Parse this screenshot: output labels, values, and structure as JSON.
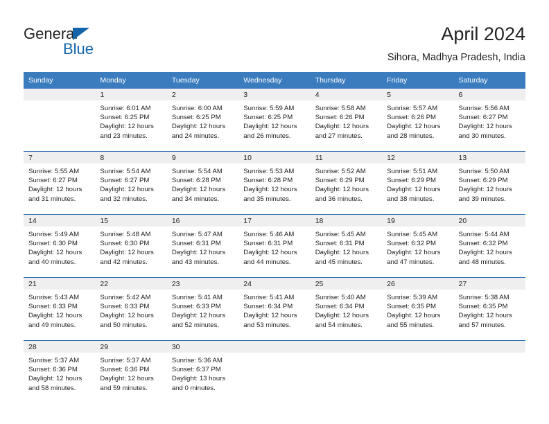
{
  "brand": {
    "name_part1": "General",
    "name_part2": "Blue",
    "logo_icon": "blue-triangle-logo"
  },
  "header": {
    "title": "April 2024",
    "subtitle": "Sihora, Madhya Pradesh, India"
  },
  "colors": {
    "header_blue": "#3b7cbf",
    "separator_blue": "#2f6daf",
    "daynum_band": "#efefef",
    "brand_blue": "#1464aa",
    "text": "#222222"
  },
  "weekday_headers": [
    "Sunday",
    "Monday",
    "Tuesday",
    "Wednesday",
    "Thursday",
    "Friday",
    "Saturday"
  ],
  "weeks": [
    [
      {
        "day": "",
        "sunrise": "",
        "sunset": "",
        "daylight_line1": "",
        "daylight_line2": ""
      },
      {
        "day": "1",
        "sunrise": "Sunrise: 6:01 AM",
        "sunset": "Sunset: 6:25 PM",
        "daylight_line1": "Daylight: 12 hours",
        "daylight_line2": "and 23 minutes."
      },
      {
        "day": "2",
        "sunrise": "Sunrise: 6:00 AM",
        "sunset": "Sunset: 6:25 PM",
        "daylight_line1": "Daylight: 12 hours",
        "daylight_line2": "and 24 minutes."
      },
      {
        "day": "3",
        "sunrise": "Sunrise: 5:59 AM",
        "sunset": "Sunset: 6:25 PM",
        "daylight_line1": "Daylight: 12 hours",
        "daylight_line2": "and 26 minutes."
      },
      {
        "day": "4",
        "sunrise": "Sunrise: 5:58 AM",
        "sunset": "Sunset: 6:26 PM",
        "daylight_line1": "Daylight: 12 hours",
        "daylight_line2": "and 27 minutes."
      },
      {
        "day": "5",
        "sunrise": "Sunrise: 5:57 AM",
        "sunset": "Sunset: 6:26 PM",
        "daylight_line1": "Daylight: 12 hours",
        "daylight_line2": "and 28 minutes."
      },
      {
        "day": "6",
        "sunrise": "Sunrise: 5:56 AM",
        "sunset": "Sunset: 6:27 PM",
        "daylight_line1": "Daylight: 12 hours",
        "daylight_line2": "and 30 minutes."
      }
    ],
    [
      {
        "day": "7",
        "sunrise": "Sunrise: 5:55 AM",
        "sunset": "Sunset: 6:27 PM",
        "daylight_line1": "Daylight: 12 hours",
        "daylight_line2": "and 31 minutes."
      },
      {
        "day": "8",
        "sunrise": "Sunrise: 5:54 AM",
        "sunset": "Sunset: 6:27 PM",
        "daylight_line1": "Daylight: 12 hours",
        "daylight_line2": "and 32 minutes."
      },
      {
        "day": "9",
        "sunrise": "Sunrise: 5:54 AM",
        "sunset": "Sunset: 6:28 PM",
        "daylight_line1": "Daylight: 12 hours",
        "daylight_line2": "and 34 minutes."
      },
      {
        "day": "10",
        "sunrise": "Sunrise: 5:53 AM",
        "sunset": "Sunset: 6:28 PM",
        "daylight_line1": "Daylight: 12 hours",
        "daylight_line2": "and 35 minutes."
      },
      {
        "day": "11",
        "sunrise": "Sunrise: 5:52 AM",
        "sunset": "Sunset: 6:29 PM",
        "daylight_line1": "Daylight: 12 hours",
        "daylight_line2": "and 36 minutes."
      },
      {
        "day": "12",
        "sunrise": "Sunrise: 5:51 AM",
        "sunset": "Sunset: 6:29 PM",
        "daylight_line1": "Daylight: 12 hours",
        "daylight_line2": "and 38 minutes."
      },
      {
        "day": "13",
        "sunrise": "Sunrise: 5:50 AM",
        "sunset": "Sunset: 6:29 PM",
        "daylight_line1": "Daylight: 12 hours",
        "daylight_line2": "and 39 minutes."
      }
    ],
    [
      {
        "day": "14",
        "sunrise": "Sunrise: 5:49 AM",
        "sunset": "Sunset: 6:30 PM",
        "daylight_line1": "Daylight: 12 hours",
        "daylight_line2": "and 40 minutes."
      },
      {
        "day": "15",
        "sunrise": "Sunrise: 5:48 AM",
        "sunset": "Sunset: 6:30 PM",
        "daylight_line1": "Daylight: 12 hours",
        "daylight_line2": "and 42 minutes."
      },
      {
        "day": "16",
        "sunrise": "Sunrise: 5:47 AM",
        "sunset": "Sunset: 6:31 PM",
        "daylight_line1": "Daylight: 12 hours",
        "daylight_line2": "and 43 minutes."
      },
      {
        "day": "17",
        "sunrise": "Sunrise: 5:46 AM",
        "sunset": "Sunset: 6:31 PM",
        "daylight_line1": "Daylight: 12 hours",
        "daylight_line2": "and 44 minutes."
      },
      {
        "day": "18",
        "sunrise": "Sunrise: 5:45 AM",
        "sunset": "Sunset: 6:31 PM",
        "daylight_line1": "Daylight: 12 hours",
        "daylight_line2": "and 45 minutes."
      },
      {
        "day": "19",
        "sunrise": "Sunrise: 5:45 AM",
        "sunset": "Sunset: 6:32 PM",
        "daylight_line1": "Daylight: 12 hours",
        "daylight_line2": "and 47 minutes."
      },
      {
        "day": "20",
        "sunrise": "Sunrise: 5:44 AM",
        "sunset": "Sunset: 6:32 PM",
        "daylight_line1": "Daylight: 12 hours",
        "daylight_line2": "and 48 minutes."
      }
    ],
    [
      {
        "day": "21",
        "sunrise": "Sunrise: 5:43 AM",
        "sunset": "Sunset: 6:33 PM",
        "daylight_line1": "Daylight: 12 hours",
        "daylight_line2": "and 49 minutes."
      },
      {
        "day": "22",
        "sunrise": "Sunrise: 5:42 AM",
        "sunset": "Sunset: 6:33 PM",
        "daylight_line1": "Daylight: 12 hours",
        "daylight_line2": "and 50 minutes."
      },
      {
        "day": "23",
        "sunrise": "Sunrise: 5:41 AM",
        "sunset": "Sunset: 6:33 PM",
        "daylight_line1": "Daylight: 12 hours",
        "daylight_line2": "and 52 minutes."
      },
      {
        "day": "24",
        "sunrise": "Sunrise: 5:41 AM",
        "sunset": "Sunset: 6:34 PM",
        "daylight_line1": "Daylight: 12 hours",
        "daylight_line2": "and 53 minutes."
      },
      {
        "day": "25",
        "sunrise": "Sunrise: 5:40 AM",
        "sunset": "Sunset: 6:34 PM",
        "daylight_line1": "Daylight: 12 hours",
        "daylight_line2": "and 54 minutes."
      },
      {
        "day": "26",
        "sunrise": "Sunrise: 5:39 AM",
        "sunset": "Sunset: 6:35 PM",
        "daylight_line1": "Daylight: 12 hours",
        "daylight_line2": "and 55 minutes."
      },
      {
        "day": "27",
        "sunrise": "Sunrise: 5:38 AM",
        "sunset": "Sunset: 6:35 PM",
        "daylight_line1": "Daylight: 12 hours",
        "daylight_line2": "and 57 minutes."
      }
    ],
    [
      {
        "day": "28",
        "sunrise": "Sunrise: 5:37 AM",
        "sunset": "Sunset: 6:36 PM",
        "daylight_line1": "Daylight: 12 hours",
        "daylight_line2": "and 58 minutes."
      },
      {
        "day": "29",
        "sunrise": "Sunrise: 5:37 AM",
        "sunset": "Sunset: 6:36 PM",
        "daylight_line1": "Daylight: 12 hours",
        "daylight_line2": "and 59 minutes."
      },
      {
        "day": "30",
        "sunrise": "Sunrise: 5:36 AM",
        "sunset": "Sunset: 6:37 PM",
        "daylight_line1": "Daylight: 13 hours",
        "daylight_line2": "and 0 minutes."
      },
      {
        "day": "",
        "sunrise": "",
        "sunset": "",
        "daylight_line1": "",
        "daylight_line2": ""
      },
      {
        "day": "",
        "sunrise": "",
        "sunset": "",
        "daylight_line1": "",
        "daylight_line2": ""
      },
      {
        "day": "",
        "sunrise": "",
        "sunset": "",
        "daylight_line1": "",
        "daylight_line2": ""
      },
      {
        "day": "",
        "sunrise": "",
        "sunset": "",
        "daylight_line1": "",
        "daylight_line2": ""
      }
    ]
  ]
}
